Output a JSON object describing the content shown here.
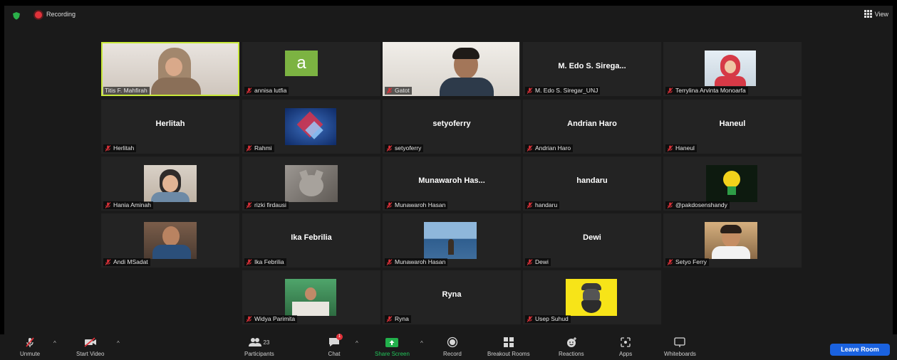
{
  "topbar": {
    "recording_label": "Recording",
    "view_label": "View"
  },
  "tiles": [
    {
      "name": "Titis F. Mahfirah",
      "big": ""
    },
    {
      "name": "annisa lutfia",
      "big": ""
    },
    {
      "name": "Gatot",
      "big": ""
    },
    {
      "name": "M. Edo S. Siregar_UNJ",
      "big": "M. Edo S. Sirega..."
    },
    {
      "name": "Terrylina Arvinta Monoarfa",
      "big": ""
    },
    {
      "name": "Herlitah",
      "big": "Herlitah"
    },
    {
      "name": "Rahmi",
      "big": ""
    },
    {
      "name": "setyoferry",
      "big": "setyoferry"
    },
    {
      "name": "Andrian Haro",
      "big": "Andrian Haro"
    },
    {
      "name": "Haneul",
      "big": "Haneul"
    },
    {
      "name": "Hania Aminah",
      "big": ""
    },
    {
      "name": "rizki firdausi",
      "big": ""
    },
    {
      "name": "Munawaroh Hasan",
      "big": "Munawaroh Has..."
    },
    {
      "name": "handaru",
      "big": "handaru"
    },
    {
      "name": "@pakdosenshandy",
      "big": ""
    },
    {
      "name": "Andi MSadat",
      "big": ""
    },
    {
      "name": "Ika Febrilia",
      "big": "Ika Febrilia"
    },
    {
      "name": "Munawaroh Hasan",
      "big": ""
    },
    {
      "name": "Dewi",
      "big": "Dewi"
    },
    {
      "name": "Setyo Ferry",
      "big": ""
    },
    {
      "name": "Widya Parimita",
      "big": ""
    },
    {
      "name": "Ryna",
      "big": "Ryna"
    },
    {
      "name": "Usep Suhud",
      "big": ""
    }
  ],
  "avatar_letter": "a",
  "toolbar": {
    "unmute": "Unmute",
    "start_video": "Start Video",
    "participants": "Participants",
    "participants_count": "23",
    "chat": "Chat",
    "chat_badge": "1",
    "share_screen": "Share Screen",
    "record": "Record",
    "breakout_rooms": "Breakout Rooms",
    "reactions": "Reactions",
    "apps": "Apps",
    "whiteboards": "Whiteboards",
    "leave_room": "Leave Room"
  },
  "colors": {
    "active_border": "#c8e83a",
    "leave_button": "#1a62e0",
    "share_green": "#22b14c",
    "muted_red": "#e0323a"
  }
}
